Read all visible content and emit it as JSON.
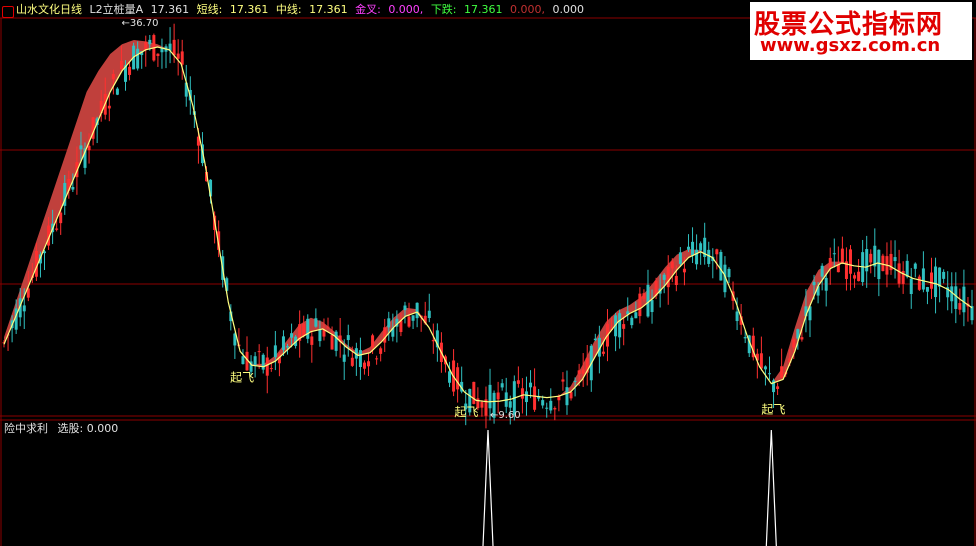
{
  "header": {
    "title": "山水文化日线",
    "indicator": "L2立桩量A",
    "indicator_value": "17.361",
    "short_label": "短线:",
    "short_value": "17.361",
    "mid_label": "中线:",
    "mid_value": "17.361",
    "golden_label": "金叉:",
    "golden_value": "0.000,",
    "fall_label": "下跌:",
    "fall_value": "17.361",
    "extra1": "0.000,",
    "extra2": "0.000",
    "arrow": "↓"
  },
  "sub_header": {
    "title": "险中求利",
    "select_label": "选股:",
    "select_value": "0.000"
  },
  "logo": {
    "text": "股票公式指标网",
    "url": "www.gsxz.com.cn"
  },
  "colors": {
    "up": "#ff3030",
    "down": "#30c0c0",
    "band": "#c0403c",
    "mid_line": "#ffff80",
    "grid": "#8b0000",
    "signal": "#ffffff"
  },
  "chart_data": {
    "type": "candlestick",
    "annotations": [
      {
        "text": "36.70",
        "kind": "high"
      },
      {
        "text": "9.60",
        "kind": "low"
      },
      {
        "text": "起飞",
        "kind": "signal"
      },
      {
        "text": "起飞",
        "kind": "signal"
      },
      {
        "text": "起飞",
        "kind": "signal"
      }
    ],
    "price_range": [
      9.6,
      36.7
    ],
    "mid_line": [
      14,
      16,
      18,
      20,
      22,
      24,
      26,
      28,
      30,
      32,
      33.5,
      34.5,
      35,
      35.2,
      35,
      34,
      31,
      27,
      22,
      17,
      13.5,
      12.5,
      12.4,
      12.8,
      13.6,
      14.4,
      14.9,
      15.1,
      14.6,
      13.8,
      13.2,
      13.4,
      14.2,
      15.2,
      16,
      16.3,
      15.2,
      13.5,
      11.8,
      10.6,
      10,
      9.9,
      9.95,
      10.1,
      10.4,
      10.3,
      10.2,
      10.3,
      10.6,
      11.5,
      13,
      14.5,
      15.6,
      16.2,
      16.6,
      17.3,
      18.2,
      19.3,
      20.2,
      20.6,
      20.2,
      19,
      17,
      14.5,
      12.4,
      11.2,
      11.5,
      13.5,
      16.2,
      18.2,
      19.4,
      19.8,
      19.6,
      19.5,
      19.8,
      19.6,
      19.1,
      18.7,
      18.5,
      18.3,
      17.9,
      17.2,
      16.6
    ],
    "upper_band": [
      14.5,
      17,
      19.5,
      22,
      24.5,
      27,
      29.5,
      32,
      33.5,
      34.7,
      35.4,
      35.7,
      35.6,
      35.4,
      35,
      34,
      31,
      27,
      22,
      17,
      13.5,
      12.6,
      12.6,
      13.2,
      14.3,
      15.4,
      15.9,
      15.6,
      14.9,
      14,
      13.4,
      13.8,
      14.9,
      15.9,
      16.6,
      16.5,
      15.2,
      13.5,
      11.8,
      10.6,
      10,
      9.9,
      9.95,
      10.1,
      10.4,
      10.3,
      10.2,
      10.3,
      11,
      12.5,
      14.2,
      15.6,
      16.4,
      16.8,
      17.4,
      18.4,
      19.5,
      20.4,
      20.8,
      20.7,
      20.2,
      19,
      17,
      14.5,
      12.4,
      11.2,
      12.4,
      15.2,
      17.8,
      19.3,
      19.9,
      19.9,
      19.6,
      19.5,
      19.8,
      19.6,
      19.1,
      18.7,
      18.5,
      18.3,
      17.9,
      17.2,
      16.6
    ],
    "signal_peaks": [
      {
        "x_index": 41,
        "value": 1
      },
      {
        "x_index": 65,
        "value": 1
      }
    ]
  }
}
